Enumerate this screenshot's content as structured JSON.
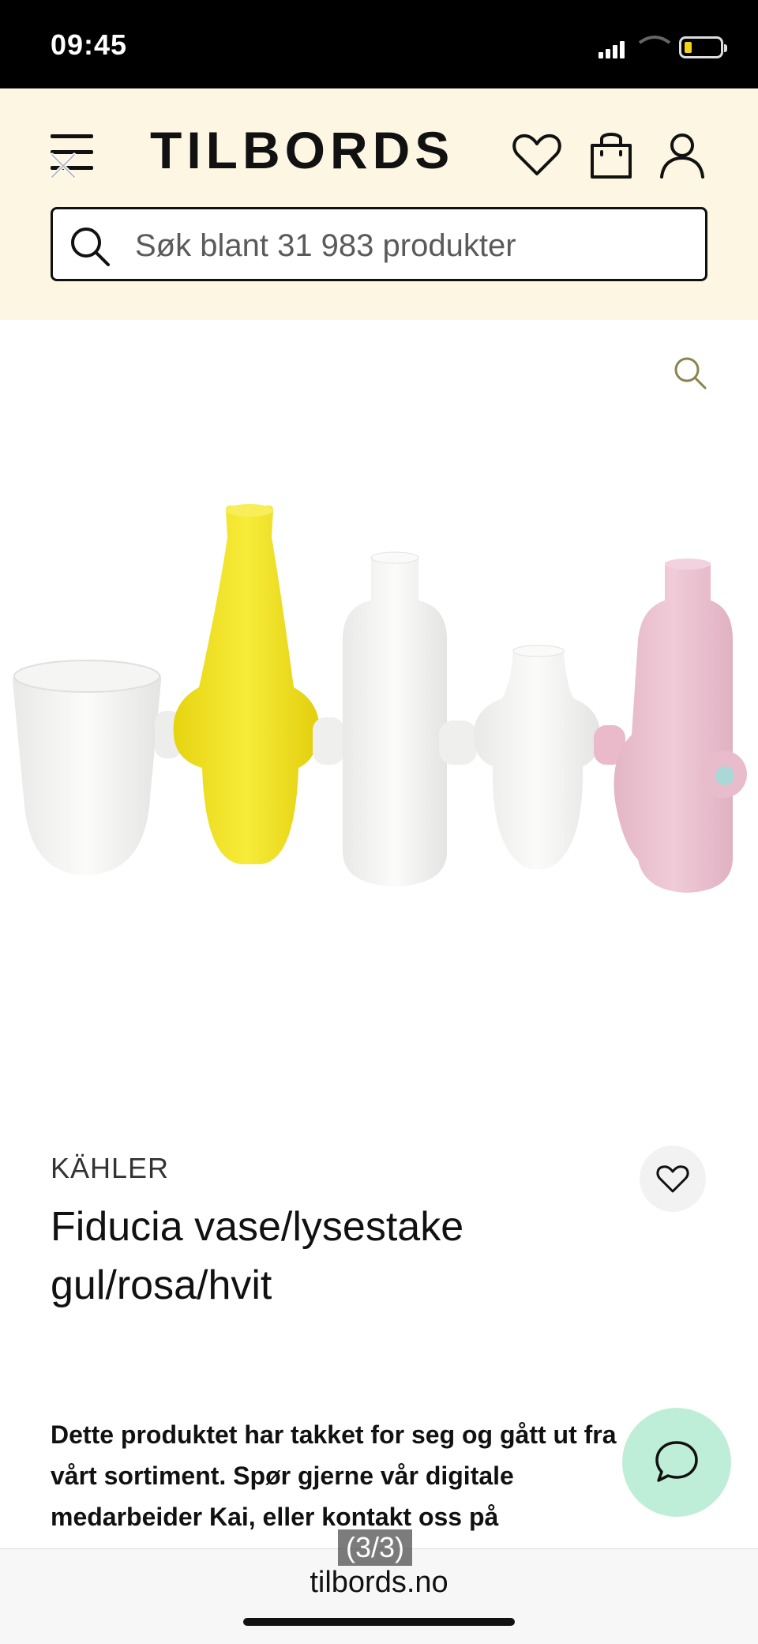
{
  "status_bar": {
    "time": "09:45"
  },
  "header": {
    "logo": "TILBORDS",
    "icons": [
      "menu-icon",
      "close-icon",
      "heart-icon",
      "shopping-bag-icon",
      "user-icon"
    ],
    "search": {
      "placeholder": "Søk blant 31 983 produkter"
    },
    "background_color": "#fcf6e3"
  },
  "product": {
    "brand": "KÄHLER",
    "title": "Fiducia vase/lysestake gul/rosa/hvit",
    "image_icon": "zoom-icon",
    "description": "Dette produktet har takket for seg og gått ut fra vårt sortiment. Spør gjerne vår digitale medarbeider Kai, eller kontakt oss på",
    "vase_colors": [
      "#f4f4f2",
      "#f2e62a",
      "#f6f6f4",
      "#f4f4f2",
      "#ecc3d1"
    ]
  },
  "chat": {
    "icon": "chat-bubble-icon",
    "color": "#bfeed8"
  },
  "browser": {
    "page_counter": "(3/3)",
    "url": "tilbords.no"
  }
}
